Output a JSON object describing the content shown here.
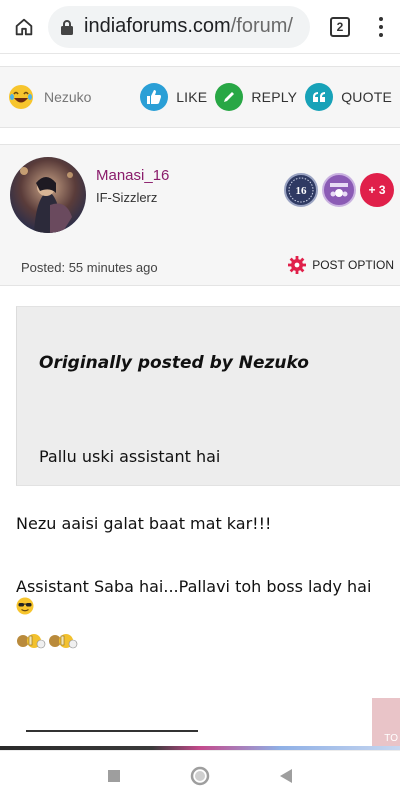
{
  "browser": {
    "url_host": "indiaforums.com",
    "url_path": "/forum/",
    "tab_count": "2",
    "icons": [
      "home-icon",
      "lock-icon",
      "tab-switcher-icon",
      "overflow-menu-icon"
    ]
  },
  "reactions": {
    "reactor_name": "Nezuko",
    "reactor_icon": "laughing-emoji-icon",
    "actions": [
      {
        "label": "LIKE",
        "icon": "thumbs-up-icon",
        "color": "#2a9fd6"
      },
      {
        "label": "REPLY",
        "icon": "pencil-icon",
        "color": "#28a745"
      },
      {
        "label": "QUOTE",
        "icon": "quote-icon",
        "color": "#17a2b8"
      }
    ]
  },
  "post": {
    "username": "Manasi_16",
    "user_title": "IF-Sizzlerz",
    "badges": [
      {
        "icon": "level-16-badge-icon",
        "text": "16"
      },
      {
        "icon": "group-badge-icon",
        "text": ""
      },
      {
        "icon": "more-badges-icon",
        "text": "+ 3"
      }
    ],
    "posted": "Posted: 55 minutes ago",
    "option_label": "POST OPTION",
    "quote": {
      "title": "Originally posted by Nezuko",
      "text": "Pallu uski assistant hai"
    },
    "lines": [
      "Nezu aaisi galat baat mat kar!!!",
      "Assistant Saba hai...Pallavi toh boss lady hai"
    ],
    "scroll_top_label": "TO"
  },
  "colors": {
    "username": "#8a1c6b",
    "plus_badge": "#e0204a",
    "gear": "#e0204a"
  }
}
